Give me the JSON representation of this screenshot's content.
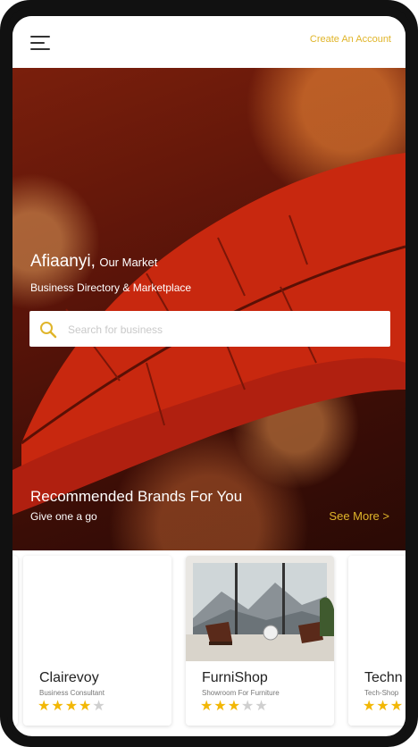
{
  "header": {
    "create_account": "Create An Account"
  },
  "hero": {
    "brand": "Afiaanyi,",
    "tagline": "Our Market",
    "subtitle": "Business Directory & Marketplace",
    "search_placeholder": "Search for business"
  },
  "recommended": {
    "title": "Recommended Brands For You",
    "subtitle": "Give one a go",
    "see_more": "See More >"
  },
  "cards": [
    {
      "name": "Clairevoy",
      "category": "Business Consultant",
      "rating": 4
    },
    {
      "name": "FurniShop",
      "category": "Showroom For  Furniture",
      "rating": 3
    },
    {
      "name": "Techn",
      "category": "Tech-Shop",
      "rating": 3
    }
  ],
  "colors": {
    "accent": "#e0b52a",
    "star": "#f2b705"
  }
}
